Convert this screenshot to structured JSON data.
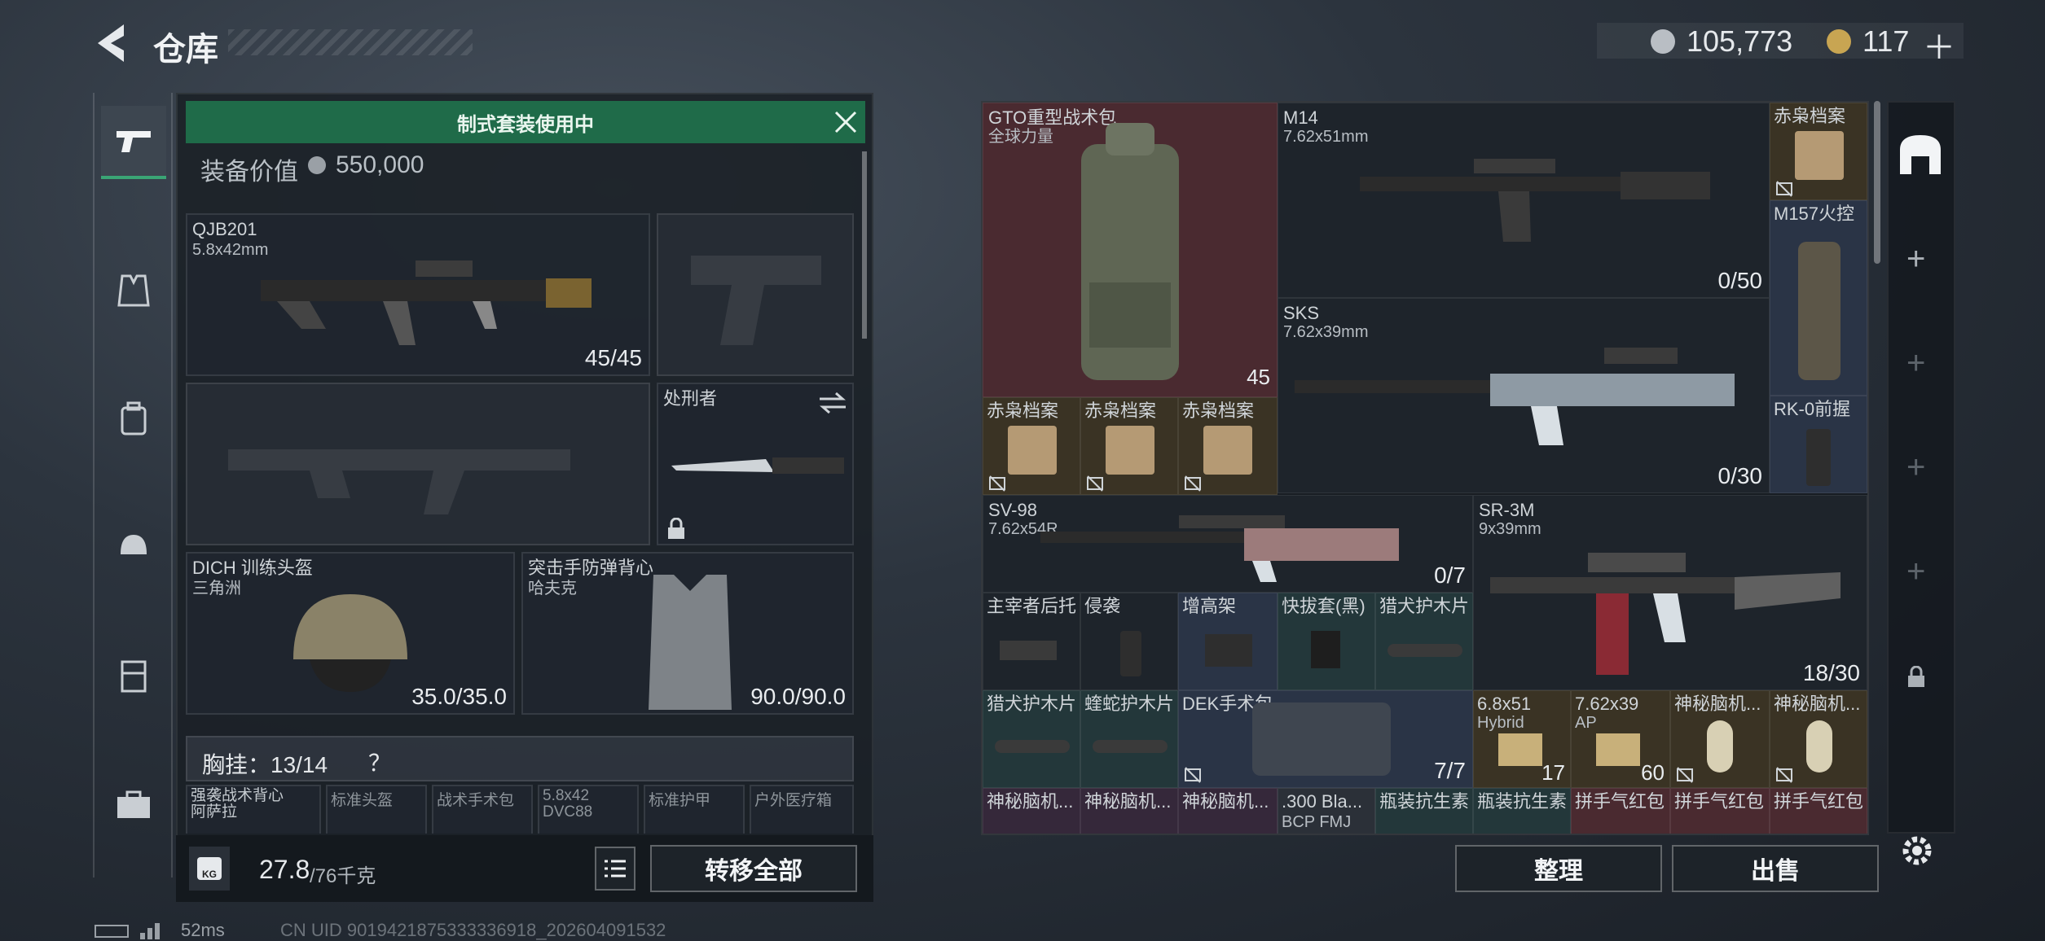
{
  "header": {
    "title": "仓库",
    "currency_silver": "105,773",
    "currency_gold": "117",
    "plus": "＋"
  },
  "left": {
    "banner": "制式套装使用中",
    "value_label": "装备价值",
    "value": "550,000",
    "primary": {
      "name": "QJB201",
      "ammo": "5.8x42mm",
      "count": "45/45"
    },
    "knife": {
      "name": "处刑者"
    },
    "helmet": {
      "name": "DICH 训练头盔",
      "faction": "三角洲",
      "durability": "35.0/35.0"
    },
    "armor": {
      "name": "突击手防弹背心",
      "faction": "哈夫克",
      "durability": "90.0/90.0"
    },
    "chest": {
      "label": "胸挂：13/14",
      "help": "？"
    },
    "mini": [
      "强袭战术背心\n阿萨拉",
      "标准头盔",
      "战术手术包",
      "5.8x42\nDVC88",
      "标准护甲",
      "户外医疗箱"
    ],
    "weight": "27.8",
    "weight_max": "/76千克",
    "transfer": "转移全部",
    "kg": "KG"
  },
  "grid": {
    "backpack": {
      "name": "GTO重型战术包",
      "faction": "全球力量",
      "count": "45"
    },
    "m14": {
      "name": "M14",
      "ammo": "7.62x51mm",
      "count": "0/50"
    },
    "sks": {
      "name": "SKS",
      "ammo": "7.62x39mm",
      "count": "0/30"
    },
    "sv98": {
      "name": "SV-98",
      "ammo": "7.62x54R",
      "count": "0/7"
    },
    "sr3m": {
      "name": "SR-3M",
      "ammo": "9x39mm",
      "count": "18/30"
    },
    "dossier": "赤枭档案",
    "m157": "M157火控",
    "rk0": "RK-0前握",
    "row_att": [
      "主宰者后托",
      "侵袭",
      "增高架",
      "快拔套(黑)",
      "猎犬护木片"
    ],
    "row2": [
      "猎犬护木片",
      "蝰蛇护木片"
    ],
    "dek": {
      "name": "DEK手术包",
      "count": "7/7"
    },
    "ammo1": {
      "name": "6.8x51",
      "sub": "Hybrid",
      "count": "17"
    },
    "ammo2": {
      "name": "7.62x39",
      "sub": "AP",
      "count": "60"
    },
    "mystery": "神秘脑机...",
    "bottom": [
      "神秘脑机...",
      "神秘脑机...",
      "神秘脑机...",
      ".300 Bla...",
      "瓶装抗生素",
      "瓶装抗生素",
      "拼手气红包",
      "拼手气红包",
      "拼手气红包"
    ],
    "bottom_sub": "BCP FMJ"
  },
  "actions": {
    "sort": "整理",
    "sell": "出售"
  },
  "status": {
    "ping": "52ms",
    "uid": "CN UID 9019421875333336918_202604091532"
  },
  "colors": {
    "accent_green": "#1f6b49",
    "selected_red": "#4a2a30"
  }
}
